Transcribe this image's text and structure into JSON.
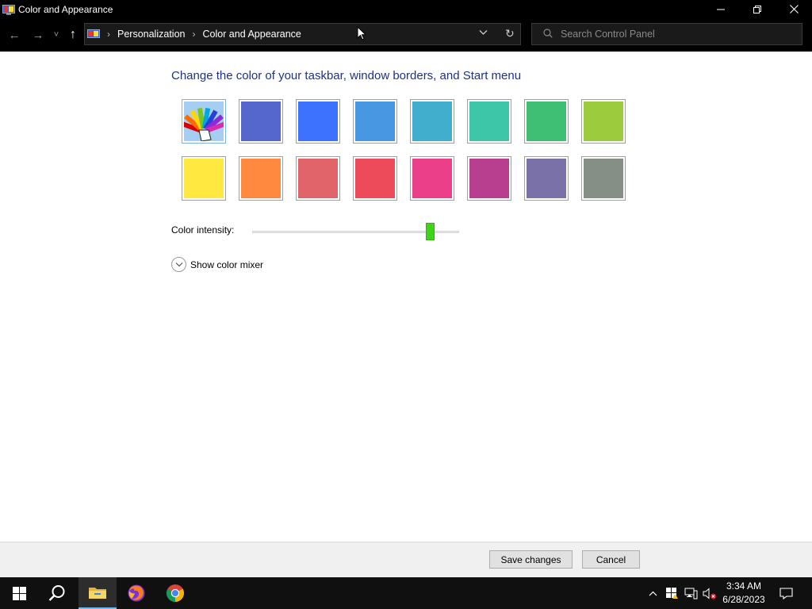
{
  "window": {
    "title": "Color and Appearance",
    "controls": {
      "minimize": "—",
      "restore": "❐",
      "close": "✕"
    }
  },
  "navigation": {
    "back": "←",
    "forward": "→",
    "recent": "˅",
    "up": "↑",
    "breadcrumb": [
      "Personalization",
      "Color and Appearance"
    ],
    "separator": "›",
    "dropdown": "⌄",
    "refresh": "↻"
  },
  "search": {
    "placeholder": "Search Control Panel",
    "value": ""
  },
  "main": {
    "heading": "Change the color of your taskbar, window borders, and Start menu",
    "swatches": [
      {
        "name": "automatic",
        "color": "#a6cdf2",
        "selected": true
      },
      {
        "name": "slate",
        "color": "#5566cc",
        "selected": false
      },
      {
        "name": "blue",
        "color": "#3d72ff",
        "selected": false
      },
      {
        "name": "sky",
        "color": "#4897e3",
        "selected": false
      },
      {
        "name": "teal",
        "color": "#42aecd",
        "selected": false
      },
      {
        "name": "aqua",
        "color": "#3dc6a8",
        "selected": false
      },
      {
        "name": "green",
        "color": "#3fbf74",
        "selected": false
      },
      {
        "name": "lime",
        "color": "#9ccb3d",
        "selected": false
      },
      {
        "name": "yellow",
        "color": "#ffe83f",
        "selected": false
      },
      {
        "name": "orange",
        "color": "#ff8a3f",
        "selected": false
      },
      {
        "name": "coral",
        "color": "#e0646a",
        "selected": false
      },
      {
        "name": "red",
        "color": "#ee4b5a",
        "selected": false
      },
      {
        "name": "pink",
        "color": "#ec3f8a",
        "selected": false
      },
      {
        "name": "magenta",
        "color": "#b83e90",
        "selected": false
      },
      {
        "name": "violet",
        "color": "#7b71a9",
        "selected": false
      },
      {
        "name": "gray",
        "color": "#858f85",
        "selected": false
      }
    ],
    "intensity_label": "Color intensity:",
    "intensity_value": 0.86,
    "mixer_label": "Show color mixer",
    "mixer_chevron": "⌄"
  },
  "footer": {
    "save_label": "Save changes",
    "cancel_label": "Cancel"
  },
  "taskbar": {
    "tray_chevron": "^",
    "time": "3:34 AM",
    "date": "6/28/2023"
  },
  "colors": {
    "accent": "#76b9ed",
    "heading": "#1e3287",
    "slider_thumb": "#3fd41a"
  }
}
